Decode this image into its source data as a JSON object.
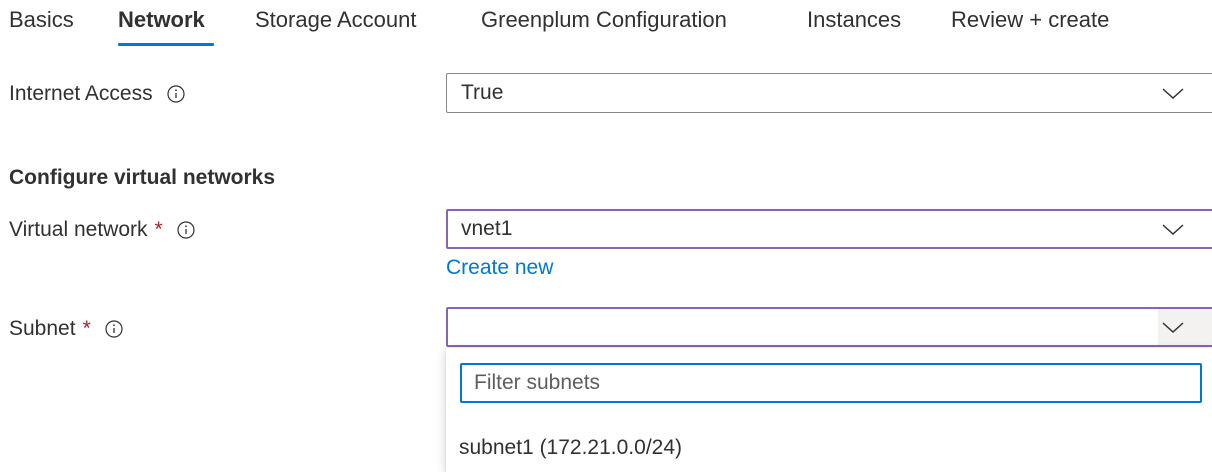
{
  "tabs": [
    {
      "label": "Basics"
    },
    {
      "label": "Network"
    },
    {
      "label": "Storage Account"
    },
    {
      "label": "Greenplum Configuration"
    },
    {
      "label": "Instances"
    },
    {
      "label": "Review + create"
    }
  ],
  "active_tab": "Network",
  "form": {
    "internet_access": {
      "label": "Internet Access",
      "value": "True"
    },
    "section_heading": "Configure virtual networks",
    "virtual_network": {
      "label": "Virtual network",
      "required_mark": "*",
      "value": "vnet1",
      "create_new_label": "Create new"
    },
    "subnet": {
      "label": "Subnet",
      "required_mark": "*",
      "value": "",
      "filter_placeholder": "Filter subnets",
      "options": [
        {
          "label": "subnet1 (172.21.0.0/24)"
        }
      ]
    }
  },
  "colors": {
    "accent": "#0078d4",
    "focus_border": "#8764b8",
    "required": "#a4262c",
    "text": "#323130"
  },
  "icons": {
    "info": "info-icon",
    "chevron": "chevron-down-icon"
  }
}
